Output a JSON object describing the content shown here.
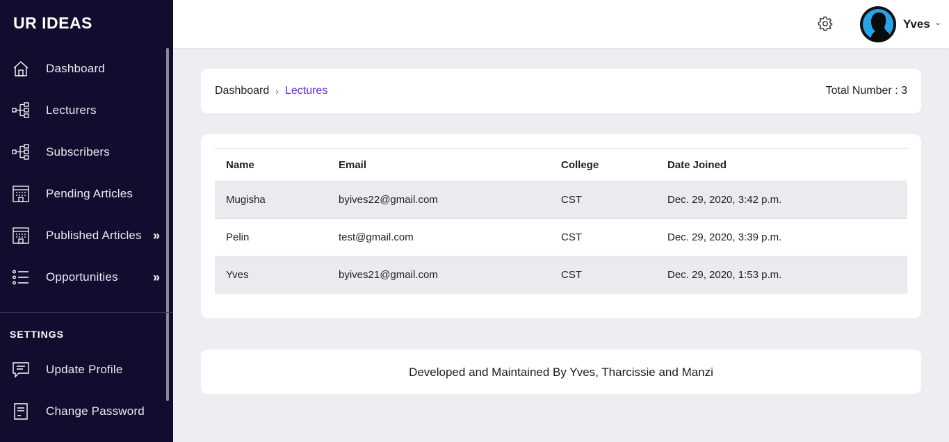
{
  "brand": "UR IDEAS",
  "sidebar": {
    "items": [
      {
        "label": "Dashboard",
        "icon": "home-icon",
        "chevron": ""
      },
      {
        "label": "Lecturers",
        "icon": "hierarchy-icon",
        "chevron": ""
      },
      {
        "label": "Subscribers",
        "icon": "hierarchy-icon",
        "chevron": ""
      },
      {
        "label": "Pending Articles",
        "icon": "building-icon",
        "chevron": ""
      },
      {
        "label": "Published Articles",
        "icon": "building-icon",
        "chevron": "»"
      },
      {
        "label": "Opportunities",
        "icon": "list-icon",
        "chevron": "»"
      }
    ],
    "settings_title": "SETTINGS",
    "settings_items": [
      {
        "label": "Update Profile",
        "icon": "chat-icon"
      },
      {
        "label": "Change Password",
        "icon": "receipt-icon"
      }
    ]
  },
  "header": {
    "user_name": "Yves",
    "caret": "⌄"
  },
  "breadcrumb": {
    "home": "Dashboard",
    "separator": "›",
    "current": "Lectures",
    "total": "Total Number : 3"
  },
  "table": {
    "columns": [
      "Name",
      "Email",
      "College",
      "Date Joined"
    ],
    "rows": [
      [
        "Mugisha",
        "byives22@gmail.com",
        "CST",
        "Dec. 29, 2020, 3:42 p.m."
      ],
      [
        "Pelin",
        "test@gmail.com",
        "CST",
        "Dec. 29, 2020, 3:39 p.m."
      ],
      [
        "Yves",
        "byives21@gmail.com",
        "CST",
        "Dec. 29, 2020, 1:53 p.m."
      ]
    ]
  },
  "footer": {
    "text": "Developed and Maintained By Yves, Tharcissie and Manzi"
  },
  "colors": {
    "sidebar_bg": "#110d2e",
    "accent": "#6c2bd9",
    "page_bg": "#eceef2",
    "striped_row": "#e9ebef"
  }
}
